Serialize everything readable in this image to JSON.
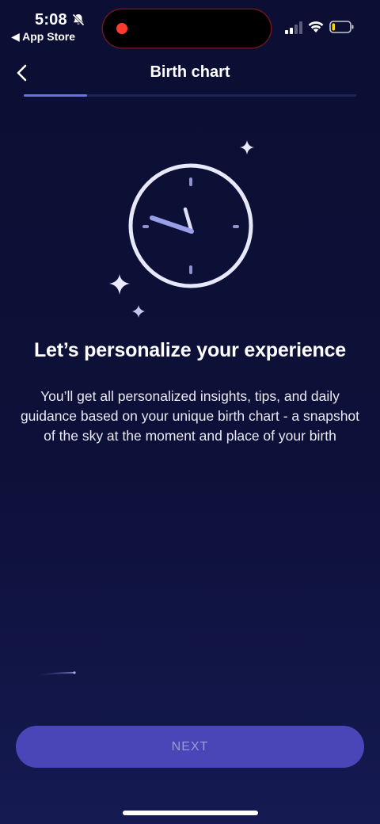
{
  "status_bar": {
    "time": "5:08",
    "back_app": "◀ App Store"
  },
  "nav": {
    "title": "Birth chart"
  },
  "progress": {
    "value": 0.19
  },
  "content": {
    "headline": "Let’s personalize your experience",
    "description": "You’ll get all personalized insights, tips, and daily guidance based on your unique birth chart - a snapshot of the sky at the moment and place of your birth"
  },
  "footer": {
    "next_label": "NEXT"
  },
  "colors": {
    "background": "#0c0f33",
    "accent": "#6c6fe6",
    "button": "#4a46b7",
    "button_text": "#9c9ad8"
  },
  "icons": [
    "bell-off-icon",
    "signal-icon",
    "wifi-icon",
    "battery-icon",
    "chevron-left-icon",
    "clock-icon",
    "sparkle-icon"
  ]
}
